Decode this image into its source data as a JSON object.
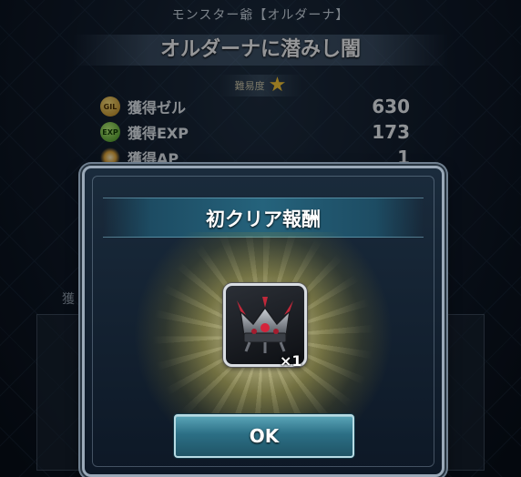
{
  "header": {
    "subtitle": "モンスター爺【オルダーナ】",
    "quest_title": "オルダーナに潜みし闇",
    "difficulty_label": "難易度",
    "difficulty_stars": 1
  },
  "rewards": [
    {
      "icon": "gil-coin-icon",
      "label": "獲得ゼル",
      "value": "630"
    },
    {
      "icon": "exp-icon",
      "label": "獲得EXP",
      "value": "173"
    },
    {
      "icon": "ap-burst-icon",
      "label": "獲得AP",
      "value": "1"
    }
  ],
  "background_panel": {
    "label": "獲"
  },
  "modal": {
    "title": "初クリア報酬",
    "item": {
      "icon": "crown-item-icon",
      "quantity": "×1"
    },
    "ok_label": "OK"
  },
  "colors": {
    "accent_teal": "#2c6f85",
    "glow_gold": "#e8d45a",
    "star": "#f2c437"
  }
}
